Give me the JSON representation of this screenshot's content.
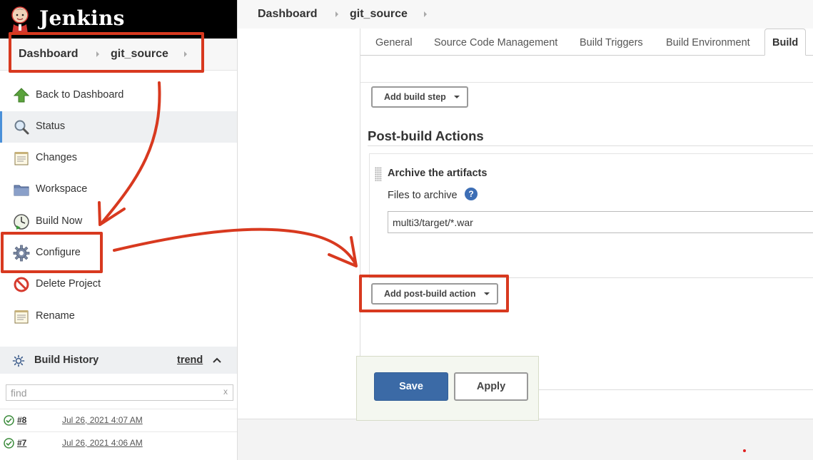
{
  "brand": {
    "name": "Jenkins",
    "icon": "jenkins-butler-logo"
  },
  "breadcrumb": {
    "items": [
      "Dashboard",
      "git_source"
    ]
  },
  "sidebar": {
    "items": [
      {
        "label": "Back to Dashboard",
        "icon": "up-arrow-icon"
      },
      {
        "label": "Status",
        "icon": "search-icon"
      },
      {
        "label": "Changes",
        "icon": "notepad-icon"
      },
      {
        "label": "Workspace",
        "icon": "folder-icon"
      },
      {
        "label": "Build Now",
        "icon": "clock-play-icon"
      },
      {
        "label": "Configure",
        "icon": "gear-icon"
      },
      {
        "label": "Delete Project",
        "icon": "no-entry-icon"
      },
      {
        "label": "Rename",
        "icon": "notepad-icon"
      }
    ],
    "active": "Status"
  },
  "build_history": {
    "title": "Build History",
    "trend_label": "trend",
    "find_placeholder": "find",
    "clear_label": "x",
    "builds": [
      {
        "number": "#8",
        "date": "Jul 26, 2021 4:07 AM",
        "status": "success"
      },
      {
        "number": "#7",
        "date": "Jul 26, 2021 4:06 AM",
        "status": "success"
      }
    ]
  },
  "config": {
    "tabs": [
      "General",
      "Source Code Management",
      "Build Triggers",
      "Build Environment",
      "Build"
    ],
    "active_tab": "Build",
    "add_build_step_label": "Add build step",
    "post_build_title": "Post-build Actions",
    "archive": {
      "title": "Archive the artifacts",
      "files_label": "Files to archive",
      "help_label": "?",
      "files_value": "multi3/target/*.war"
    },
    "add_post_build_label": "Add post-build action",
    "save_label": "Save",
    "apply_label": "Apply"
  },
  "colors": {
    "annotation_red": "#d8391f",
    "primary_blue": "#3b6aa6",
    "success_green": "#3a8a3a"
  }
}
